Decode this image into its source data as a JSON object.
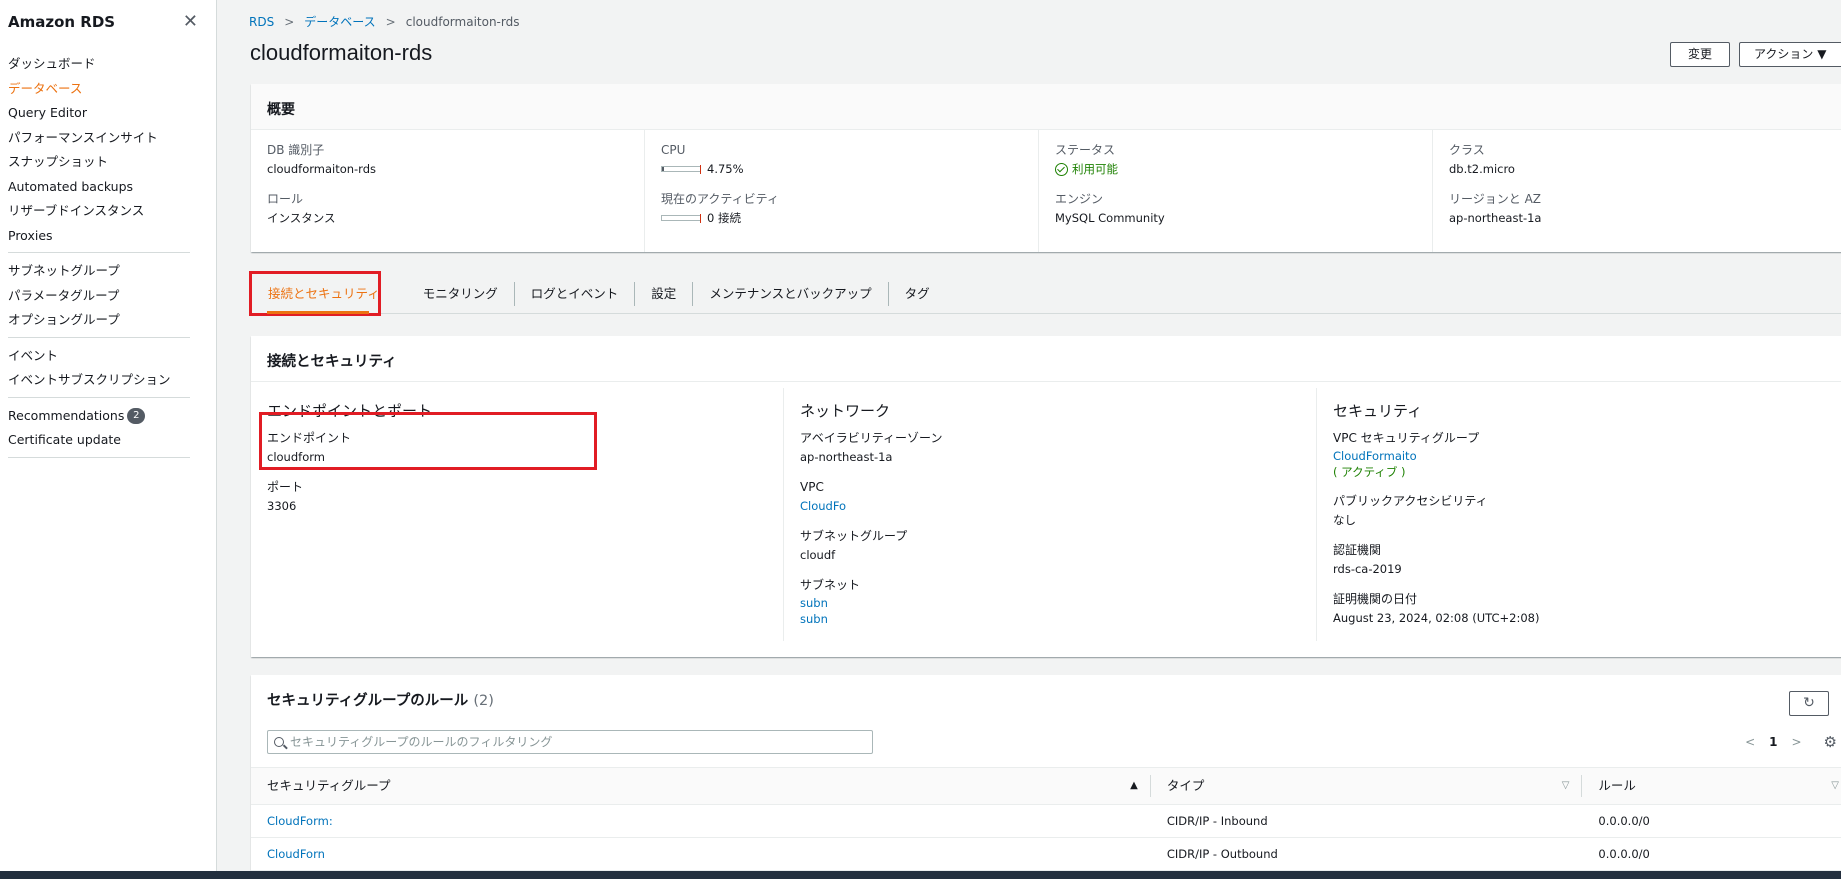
{
  "sidebar": {
    "title": "Amazon RDS",
    "close_glyph": "✕",
    "groups": [
      [
        "ダッシュボード",
        "データベース",
        "Query Editor",
        "パフォーマンスインサイト",
        "スナップショット",
        "Automated backups",
        "リザーブドインスタンス",
        "Proxies"
      ],
      [
        "サブネットグループ",
        "パラメータグループ",
        "オプショングループ"
      ],
      [
        "イベント",
        "イベントサブスクリプション"
      ]
    ],
    "recommendations_label": "Recommendations",
    "recommendations_count": "2",
    "certificate_update": "Certificate update",
    "active_item": "データベース"
  },
  "breadcrumb": {
    "root": "RDS",
    "databases": "データベース",
    "current": "cloudformaiton-rds",
    "separator": ">"
  },
  "page": {
    "title": "cloudformaiton-rds",
    "modify_label": "変更",
    "actions_label": "アクション ▼"
  },
  "summary": {
    "heading": "概要",
    "db_id_label": "DB 識別子",
    "db_id": "cloudformaiton-rds",
    "role_label": "ロール",
    "role": "インスタンス",
    "cpu_label": "CPU",
    "cpu_value": "4.75%",
    "cpu_fraction": 0.0475,
    "activity_label": "現在のアクティビティ",
    "activity_value": "0 接続",
    "activity_fraction": 0,
    "status_label": "ステータス",
    "status_value": "利用可能",
    "engine_label": "エンジン",
    "engine_value": "MySQL Community",
    "class_label": "クラス",
    "class_value": "db.t2.micro",
    "region_label": "リージョンと AZ",
    "region_value": "ap-northeast-1a"
  },
  "tabs": [
    "接続とセキュリティ",
    "モニタリング",
    "ログとイベント",
    "設定",
    "メンテナンスとバックアップ",
    "タグ"
  ],
  "connectivity": {
    "heading": "接続とセキュリティ",
    "endpoint_section": "エンドポイントとポート",
    "endpoint_label": "エンドポイント",
    "endpoint_value": "cloudform",
    "port_label": "ポート",
    "port_value": "3306",
    "network_section": "ネットワーク",
    "az_label": "アベイラビリティーゾーン",
    "az_value": "ap-northeast-1a",
    "vpc_label": "VPC",
    "vpc_value": "CloudFo",
    "subnet_group_label": "サブネットグループ",
    "subnet_group_value": "cloudf",
    "subnets_label": "サブネット",
    "subnet_1": "subn",
    "subnet_2": "subn",
    "security_section": "セキュリティ",
    "vpc_sg_label": "VPC セキュリティグループ",
    "vpc_sg_value": "CloudFormaito",
    "vpc_sg_state": "( アクティブ )",
    "public_label": "パブリックアクセシビリティ",
    "public_value": "なし",
    "ca_label": "認証機関",
    "ca_value": "rds-ca-2019",
    "ca_date_label": "証明機関の日付",
    "ca_date_value": "August 23, 2024, 02:08 (UTC+2:08)"
  },
  "rules": {
    "heading": "セキュリティグループのルール",
    "count": "(2)",
    "refresh_glyph": "↻",
    "search_placeholder": "セキュリティグループのルールのフィルタリング",
    "page": "1",
    "columns": [
      "セキュリティグループ",
      "タイプ",
      "ルール"
    ],
    "rows": [
      {
        "group": "CloudForm:",
        "type": "CIDR/IP - Inbound",
        "rule": "0.0.0.0/0"
      },
      {
        "group": "CloudForn",
        "type": "CIDR/IP - Outbound",
        "rule": "0.0.0.0/0"
      }
    ]
  },
  "colors": {
    "accent": "#ec7211",
    "link": "#0073bb",
    "highlight": "#e11c24",
    "success": "#1d8102"
  }
}
